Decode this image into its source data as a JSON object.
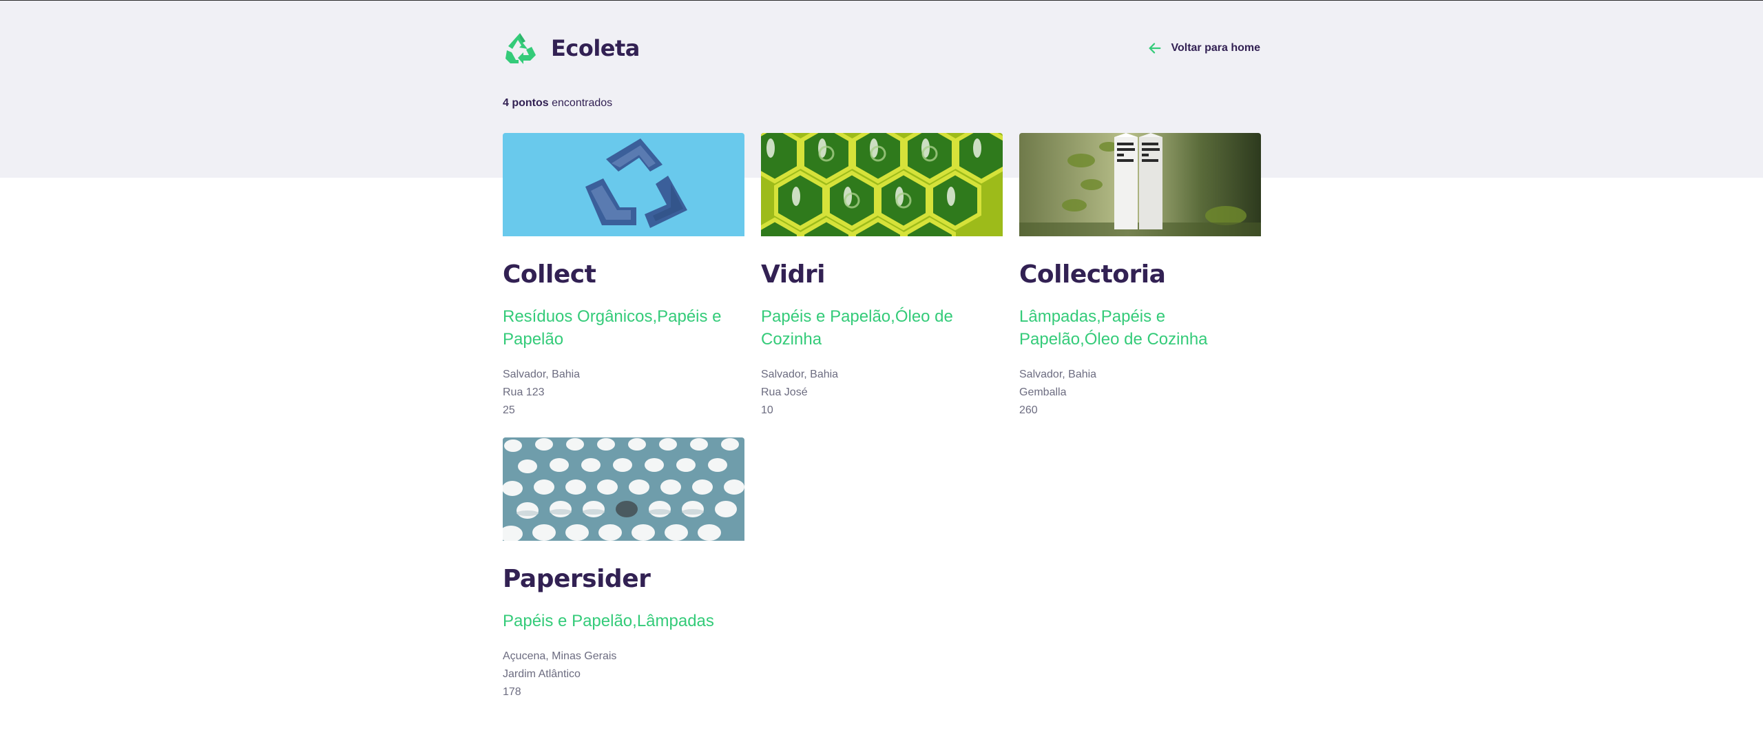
{
  "app": {
    "name": "Ecoleta",
    "back_label": "Voltar para home",
    "accent_color": "#34cb79",
    "title_color": "#322153"
  },
  "results": {
    "count_bold": "4 pontos",
    "count_rest": " encontrados"
  },
  "points": [
    {
      "title": "Collect",
      "items": "Resíduos Orgânicos,Papéis e Papelão",
      "city": "Salvador, Bahia",
      "street": "Rua 123",
      "number": "25",
      "image": "denim-recycle-symbol-photo"
    },
    {
      "title": "Vidri",
      "items": "Papéis e Papelão,Óleo de Cozinha",
      "city": "Salvador, Bahia",
      "street": "Rua José",
      "number": "10",
      "image": "green-bottles-in-crate-photo"
    },
    {
      "title": "Collectoria",
      "items": "Lâmpadas,Papéis e Papelão,Óleo de Cozinha",
      "city": "Salvador, Bahia",
      "street": "Gemballa",
      "number": "260",
      "image": "boxed-water-cartons-photo"
    },
    {
      "title": "Papersider",
      "items": "Papéis e Papelão,Lâmpadas",
      "city": "Açucena, Minas Gerais",
      "street": "Jardim Atlântico",
      "number": "178",
      "image": "plastic-bottle-caps-photo"
    }
  ]
}
